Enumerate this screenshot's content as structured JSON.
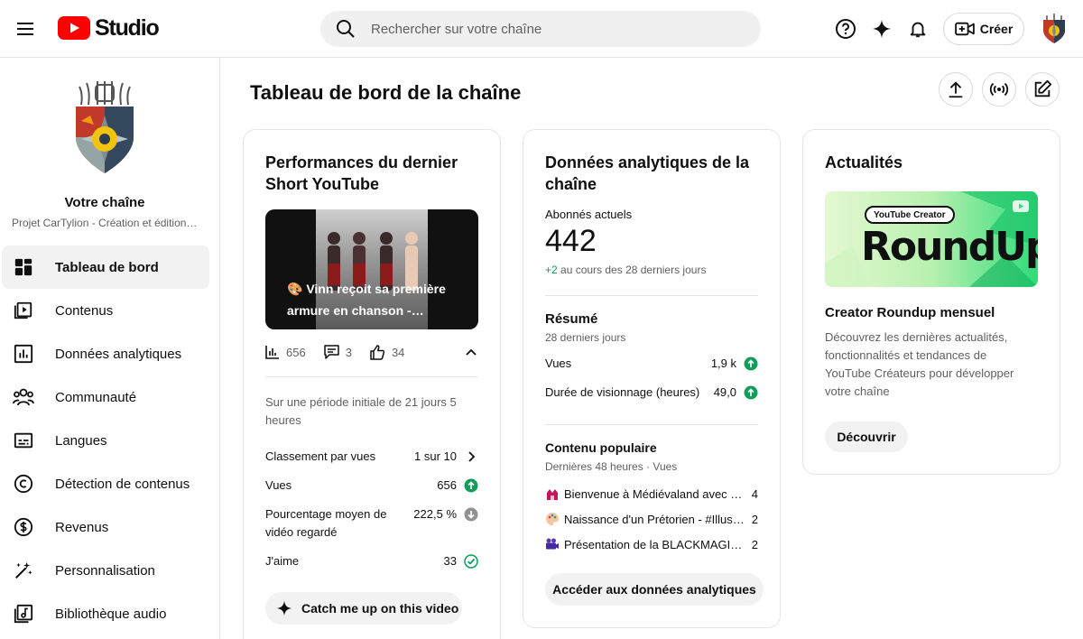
{
  "header": {
    "logo_text": "Studio",
    "search_placeholder": "Rechercher sur votre chaîne",
    "create_label": "Créer"
  },
  "sidebar": {
    "channel_title": "Votre chaîne",
    "channel_name": "Projet CarTylion - Création et édition…",
    "items": [
      {
        "label": "Tableau de bord",
        "icon": "dashboard-icon",
        "active": true
      },
      {
        "label": "Contenus",
        "icon": "content-icon"
      },
      {
        "label": "Données analytiques",
        "icon": "analytics-icon"
      },
      {
        "label": "Communauté",
        "icon": "community-icon"
      },
      {
        "label": "Langues",
        "icon": "subtitles-icon"
      },
      {
        "label": "Détection de contenus",
        "icon": "copyright-icon"
      },
      {
        "label": "Revenus",
        "icon": "dollar-icon"
      },
      {
        "label": "Personnalisation",
        "icon": "magic-wand-icon"
      },
      {
        "label": "Bibliothèque audio",
        "icon": "audio-library-icon"
      }
    ]
  },
  "main": {
    "page_title": "Tableau de bord de la chaîne"
  },
  "short_card": {
    "title": "Performances du dernier Short YouTube",
    "video_caption": "🎨 Vinn reçoit sa première armure en chanson -…",
    "views_count": "656",
    "comments_count": "3",
    "likes_count": "34",
    "period": "Sur une période initiale de 21 jours 5 heures",
    "metrics": [
      {
        "label": "Classement par vues",
        "value": "1 sur 10"
      },
      {
        "label": "Vues",
        "value": "656"
      },
      {
        "label": "Pourcentage moyen de vidéo regardé",
        "value": "222,5 %"
      },
      {
        "label": "J'aime",
        "value": "33"
      }
    ],
    "catch_up_label": "Catch me up on this video"
  },
  "analytics_card": {
    "title": "Données analytiques de la chaîne",
    "subscribers_label": "Abonnés actuels",
    "subscribers_value": "442",
    "subscribers_delta": "+2",
    "subscribers_delta_text": " au cours des 28 derniers jours",
    "summary_title": "Résumé",
    "summary_period": "28 derniers jours",
    "summary_rows": [
      {
        "label": "Vues",
        "value": "1,9 k"
      },
      {
        "label": "Durée de visionnage (heures)",
        "value": "49,0"
      }
    ],
    "popular_title": "Contenu populaire",
    "popular_period": "Dernières 48 heures · Vues",
    "popular_rows": [
      {
        "title": "Bienvenue à Médiévaland avec la…",
        "value": "4"
      },
      {
        "title": "Naissance d'un Prétorien - #Illust…",
        "value": "2"
      },
      {
        "title": "Présentation de la BLACKMAGIC…",
        "value": "2"
      }
    ],
    "analytics_button": "Accéder aux données analytiques"
  },
  "news_card": {
    "title": "Actualités",
    "image_badge": "YouTube Creator",
    "image_text": "RoundUp",
    "item_title": "Creator Roundup mensuel",
    "item_desc": "Découvrez les dernières actualités, fonctionnalités et tendances de YouTube Créateurs pour développer votre chaîne",
    "discover_button": "Découvrir"
  },
  "colors": {
    "brand_red": "#ff0000",
    "up_green": "#0f9d58",
    "neutral_grey": "#909090"
  }
}
